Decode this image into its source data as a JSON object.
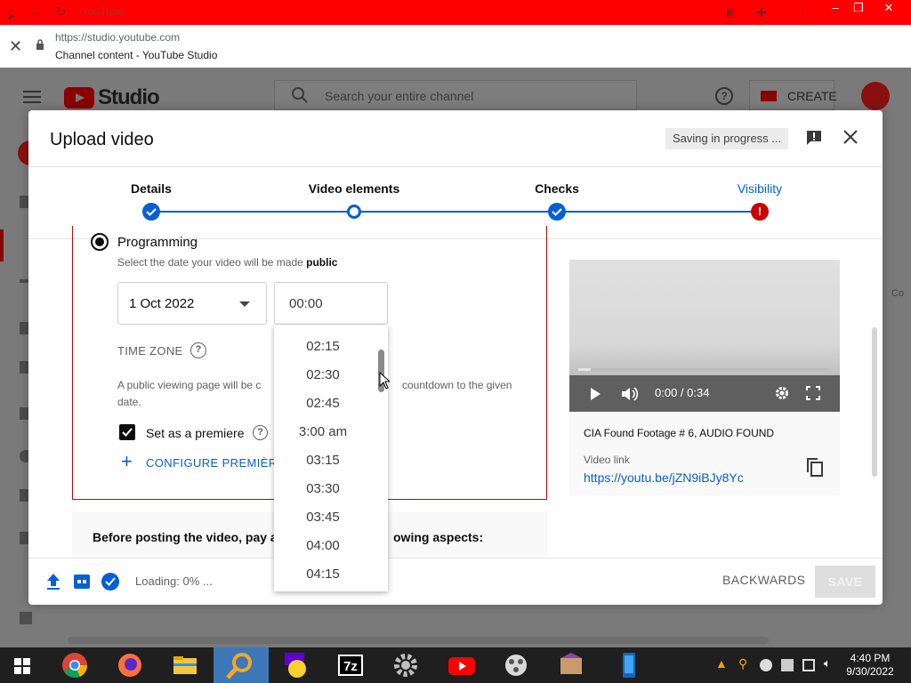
{
  "browser": {
    "tab_title": "YouTube",
    "url": "https://studio.youtube.com",
    "page_title": "Channel content - YouTube Studio"
  },
  "studio": {
    "logo_text": "Studio",
    "search_placeholder": "Search your entire channel",
    "create_label": "CREATE",
    "side_partial": "Co"
  },
  "modal": {
    "title": "Upload video",
    "saving_status": "Saving in progress ...",
    "steps": [
      {
        "label": "Details",
        "state": "done"
      },
      {
        "label": "Video elements",
        "state": "current"
      },
      {
        "label": "Checks",
        "state": "done"
      },
      {
        "label": "Visibility",
        "state": "error"
      }
    ],
    "schedule": {
      "option_label": "Programming",
      "subtitle_prefix": "Select the date your video will be made ",
      "subtitle_bold": "public",
      "date_value": "1 Oct 2022",
      "time_value": "00:00",
      "timezone_label": "TIME ZONE",
      "desc_part1": "A public viewing page will be c",
      "desc_part2": "countdown to the given",
      "desc_part3": "date.",
      "premiere_label": "Set as a premiere",
      "configure_label": "CONFIGURE PREMIÈRE"
    },
    "time_options": [
      "02:15",
      "02:30",
      "02:45",
      "3:00 am",
      "03:15",
      "03:30",
      "03:45",
      "04:00",
      "04:15"
    ],
    "notice_part1": "Before posting the video, pay a",
    "notice_part2": "owing aspects:",
    "preview": {
      "time": "0:00 / 0:34",
      "progress": 0,
      "video_title": "CIA Found Footage # 6, AUDIO FOUND",
      "link_label": "Video link",
      "link": "https://youtu.be/jZN9iBJy8Yc"
    },
    "footer": {
      "status": "Loading: 0% ...",
      "back_label": "BACKWARDS",
      "save_label": "SAVE"
    }
  },
  "taskbar": {
    "time": "4:40 PM",
    "date": "9/30/2022"
  },
  "colors": {
    "accent": "#065fd4",
    "error": "#cc0000",
    "browser_bar": "#ff0000"
  }
}
